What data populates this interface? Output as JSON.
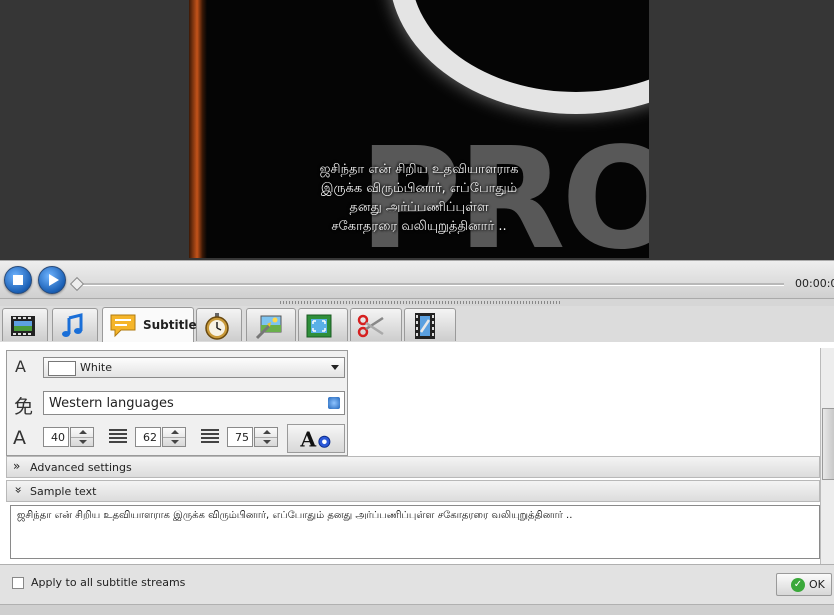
{
  "video": {
    "subtitle_lines": [
      "ஜசிந்தா என் சிறிய உதவியாளராக",
      "இருக்க விரும்பினார், எப்போதும்",
      "தனது அர்ப்பணிப்புள்ள",
      "சகோதரரை வலியுறுத்தினார் .."
    ],
    "background_text": "PRO"
  },
  "player": {
    "stop_icon": "stop-icon",
    "play_icon": "play-icon",
    "time": "00:00:0",
    "progress": 0
  },
  "tabs": [
    {
      "icon": "video-tab-icon"
    },
    {
      "icon": "music-note-icon"
    },
    {
      "icon": "subtitle-bubble-icon",
      "label": "Subtitle",
      "active": true
    },
    {
      "icon": "stopwatch-icon"
    },
    {
      "icon": "image-effects-icon"
    },
    {
      "icon": "crop-icon"
    },
    {
      "icon": "scissors-icon"
    },
    {
      "icon": "film-settings-icon"
    }
  ],
  "subtitle_settings": {
    "color_value": "White",
    "language_value": "Western languages",
    "font_size": "40",
    "line_spacing": "62",
    "margin": "75"
  },
  "sections": {
    "advanced_label": "Advanced settings",
    "sample_label": "Sample text",
    "sample_text": "ஜசிந்தா என் சிறிய உதவியாளராக இருக்க விரும்பினார், எப்போதும் தனது அர்ப்பணிப்புள்ள சகோதரரை வலியுறுத்தினார் .."
  },
  "footer": {
    "apply_label": "Apply to all subtitle streams",
    "apply_checked": false,
    "ok_label": "OK"
  },
  "colors": {
    "accent": "#1a5fb4",
    "ok_green": "#3aa83a"
  }
}
